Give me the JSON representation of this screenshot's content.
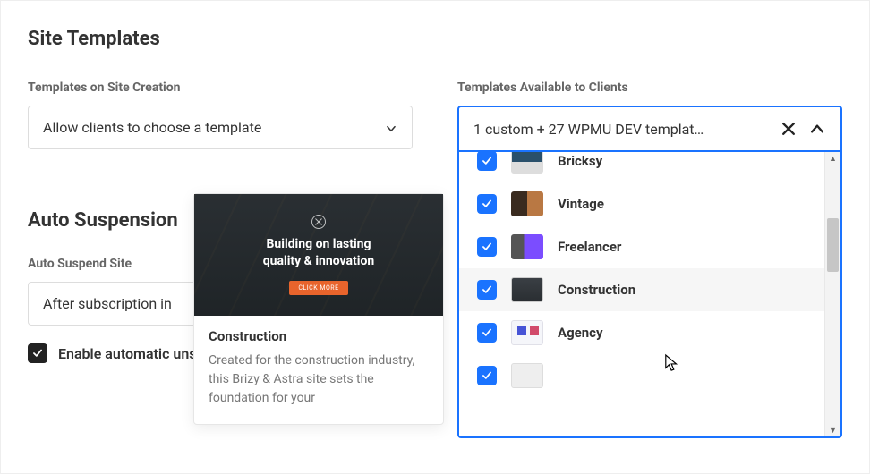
{
  "section1": {
    "title": "Site Templates",
    "left": {
      "label": "Templates on Site Creation",
      "select_value": "Allow clients to choose a template"
    },
    "right": {
      "label": "Templates Available to Clients",
      "select_value": "1 custom + 27 WPMU DEV templat…",
      "items": [
        {
          "name": "Bricksy",
          "checked": true,
          "thumb": "th-bricksy",
          "partial": true
        },
        {
          "name": "Vintage",
          "checked": true,
          "thumb": "th-vintage"
        },
        {
          "name": "Freelancer",
          "checked": true,
          "thumb": "th-freelancer"
        },
        {
          "name": "Construction",
          "checked": true,
          "thumb": "th-construction",
          "hover": true
        },
        {
          "name": "Agency",
          "checked": true,
          "thumb": "th-agency"
        },
        {
          "name": "",
          "checked": true,
          "thumb": "th-partial",
          "partial_bottom": true
        }
      ]
    }
  },
  "preview": {
    "hero_line1": "Building on lasting",
    "hero_line2": "quality & innovation",
    "hero_btn": "CLICK MORE",
    "title": "Construction",
    "desc": "Created for the construction industry, this Brizy & Astra site sets the foundation for your"
  },
  "section2": {
    "title": "Auto Suspension",
    "label": "Auto Suspend Site",
    "select_value": "After subscription in",
    "checkbox_label": "Enable automatic unsuspension when the pending in"
  }
}
